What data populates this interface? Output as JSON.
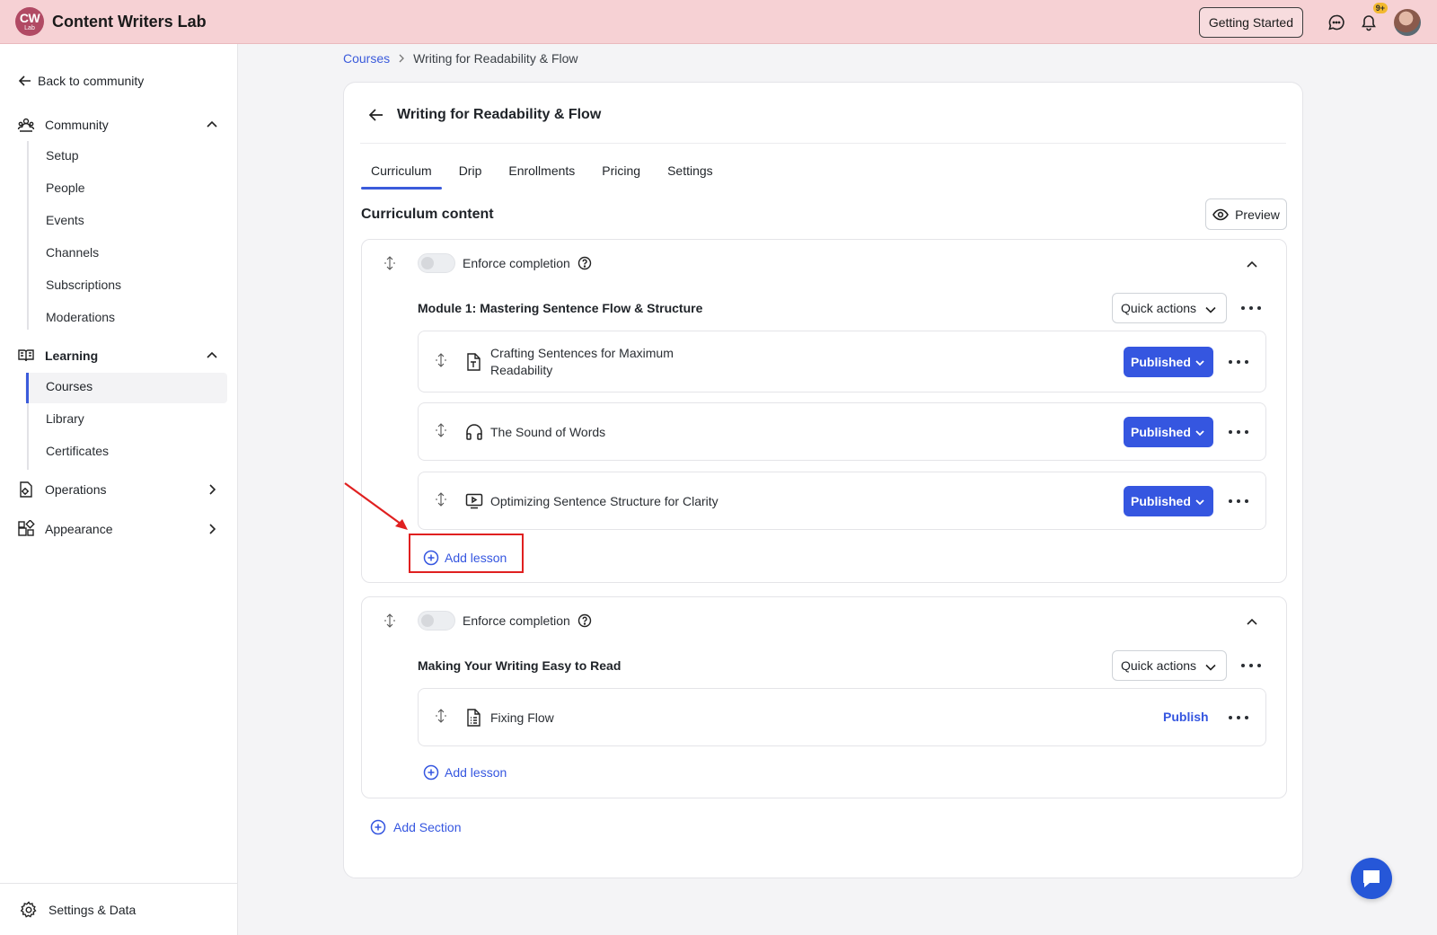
{
  "app": {
    "logo_text": "CW",
    "logo_subtext": "Lab",
    "title": "Content Writers Lab"
  },
  "topbar": {
    "getting_started": "Getting Started",
    "notifications_badge": "9+"
  },
  "sidebar": {
    "back_label": "Back to community",
    "community": {
      "label": "Community",
      "items": [
        "Setup",
        "People",
        "Events",
        "Channels",
        "Subscriptions",
        "Moderations"
      ]
    },
    "learning": {
      "label": "Learning",
      "items": [
        "Courses",
        "Library",
        "Certificates"
      ],
      "active": "Courses"
    },
    "operations": {
      "label": "Operations"
    },
    "appearance": {
      "label": "Appearance"
    },
    "settings_label": "Settings & Data"
  },
  "breadcrumb": {
    "root": "Courses",
    "current": "Writing for Readability & Flow"
  },
  "course": {
    "title": "Writing for Readability & Flow",
    "tabs": [
      "Curriculum",
      "Drip",
      "Enrollments",
      "Pricing",
      "Settings"
    ],
    "active_tab": "Curriculum",
    "curriculum_heading": "Curriculum content",
    "preview_label": "Preview"
  },
  "sections": [
    {
      "enforce_label": "Enforce completion",
      "enforce_on": false,
      "title": "Module 1: Mastering Sentence Flow & Structure",
      "quick_actions": "Quick actions",
      "add_lesson": "Add lesson",
      "lessons": [
        {
          "title_line1": "Crafting Sentences for Maximum",
          "title_line2": "Readability",
          "icon": "text-file-icon",
          "status": "Published"
        },
        {
          "title": "The Sound of Words",
          "icon": "headphones-icon",
          "status": "Published"
        },
        {
          "title": "Optimizing Sentence Structure for Clarity",
          "icon": "video-icon",
          "status": "Published"
        }
      ]
    },
    {
      "enforce_label": "Enforce completion",
      "enforce_on": false,
      "title": "Making Your Writing Easy to Read",
      "quick_actions": "Quick actions",
      "add_lesson": "Add lesson",
      "lessons": [
        {
          "title": "Fixing Flow",
          "icon": "document-icon",
          "status": "Publish"
        }
      ]
    }
  ],
  "add_section": "Add Section",
  "colors": {
    "topbar": "#f6d1d4",
    "accent": "#3556e0",
    "highlight": "#e02020"
  }
}
